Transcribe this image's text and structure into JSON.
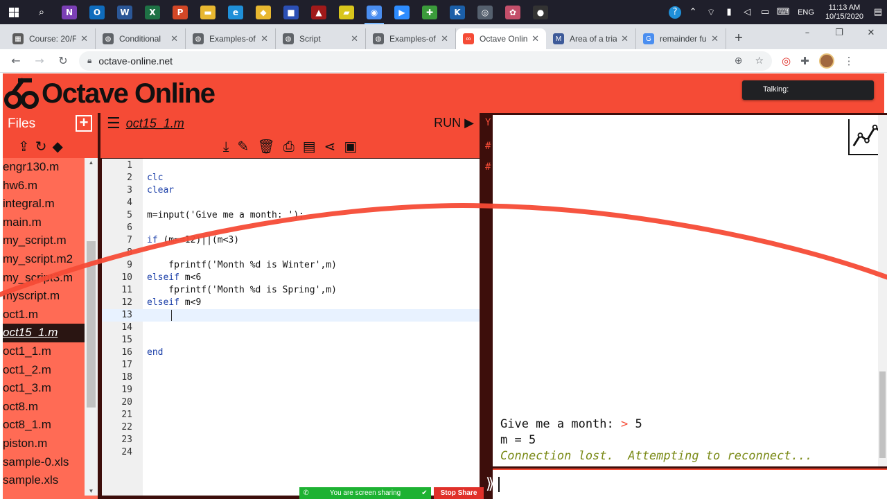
{
  "taskbar": {
    "apps": [
      {
        "name": "onenote",
        "glyph": "N",
        "color": "#7b3fb5"
      },
      {
        "name": "outlook",
        "glyph": "O",
        "color": "#0f6cbd"
      },
      {
        "name": "word",
        "glyph": "W",
        "color": "#2b5797"
      },
      {
        "name": "excel",
        "glyph": "X",
        "color": "#1e7145"
      },
      {
        "name": "powerpoint",
        "glyph": "P",
        "color": "#d24726"
      },
      {
        "name": "file-explorer",
        "glyph": "▬",
        "color": "#e8b730"
      },
      {
        "name": "edge",
        "glyph": "e",
        "color": "#1f8fd8"
      },
      {
        "name": "sticky",
        "glyph": "◆",
        "color": "#e8b730"
      },
      {
        "name": "app-blue",
        "glyph": "■",
        "color": "#2b4fb5"
      },
      {
        "name": "app-red",
        "glyph": "▲",
        "color": "#a11a1a"
      },
      {
        "name": "notes",
        "glyph": "▰",
        "color": "#d8c51c"
      },
      {
        "name": "chrome",
        "glyph": "◉",
        "color": "#4a8ef0"
      },
      {
        "name": "zoom",
        "glyph": "▶",
        "color": "#2d8cff"
      },
      {
        "name": "app-green",
        "glyph": "✚",
        "color": "#3b9b3b"
      },
      {
        "name": "app-k",
        "glyph": "K",
        "color": "#1b5fa8"
      },
      {
        "name": "camera",
        "glyph": "◎",
        "color": "#55606e"
      },
      {
        "name": "app-flower",
        "glyph": "✿",
        "color": "#c44f6a"
      },
      {
        "name": "recorder",
        "glyph": "●",
        "color": "#333333"
      }
    ],
    "clock_time": "11:13 AM",
    "clock_date": "10/15/2020",
    "lang": "ENG"
  },
  "browser": {
    "tabs": [
      {
        "title": "Course: 20/F",
        "fav_color": "#5c5c5c",
        "glyph": "▦",
        "active": false
      },
      {
        "title": "Conditional",
        "fav_color": "#5f6368",
        "glyph": "◍",
        "active": false
      },
      {
        "title": "Examples-of",
        "fav_color": "#5f6368",
        "glyph": "◍",
        "active": false
      },
      {
        "title": "Script",
        "fav_color": "#5f6368",
        "glyph": "◍",
        "active": false
      },
      {
        "title": "Examples-of",
        "fav_color": "#5f6368",
        "glyph": "◍",
        "active": false
      },
      {
        "title": "Octave Onlin",
        "fav_color": "#f54b36",
        "glyph": "∞",
        "active": true
      },
      {
        "title": "Area of a tria",
        "fav_color": "#3d5a99",
        "glyph": "M",
        "active": false
      },
      {
        "title": "remainder fu",
        "fav_color": "#4a8ef0",
        "glyph": "G",
        "active": false
      }
    ],
    "url": "octave-online.net"
  },
  "octave": {
    "logo_text": "Octave Online",
    "talking_label": "Talking:",
    "files_title": "Files",
    "files": [
      "engr130.m",
      "hw6.m",
      "integral.m",
      "main.m",
      "my_script.m",
      "my_script.m2",
      "my_script3.m",
      "myscript.m",
      "oct1.m",
      "oct15_1.m",
      "oct1_1.m",
      "oct1_2.m",
      "oct1_3.m",
      "oct8.m",
      "oct8_1.m",
      "piston.m",
      "sample-0.xls",
      "sample.xls"
    ],
    "active_file": "oct15_1.m",
    "editor_filename": "oct15_1.m",
    "run_label": "RUN ▶",
    "code_lines": [
      "",
      "clc",
      "clear",
      "",
      "m=input('Give me a month: ');",
      "",
      "if (m==12)||(m<3)",
      "",
      "    fprintf('Month %d is Winter',m)",
      "elseif m<6",
      "    fprintf('Month %d is Spring',m)",
      "elseif m<9",
      "    ",
      "",
      "",
      "end",
      "",
      "",
      "",
      "",
      "",
      "",
      "",
      ""
    ],
    "current_line": 13,
    "console": {
      "prompt_text": "Give me a month: ",
      "prompt_arrow": ">",
      "prompt_value": " 5",
      "result_line": "m = 5",
      "error_line": "Connection lost.  Attempting to reconnect...",
      "input_prompt": "⟫"
    }
  },
  "screen_share": {
    "message": "You are screen sharing",
    "stop_label": "Stop Share"
  }
}
